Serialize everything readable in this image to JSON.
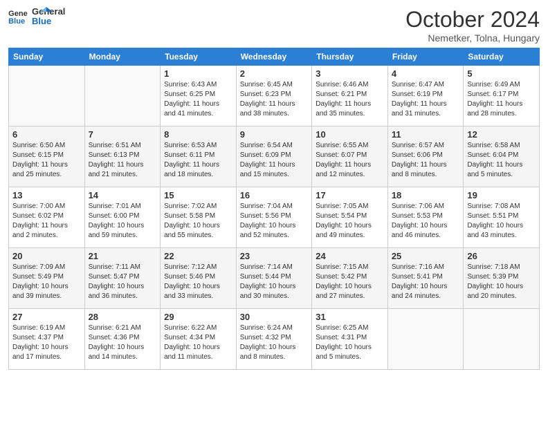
{
  "header": {
    "logo_general": "General",
    "logo_blue": "Blue",
    "month_title": "October 2024",
    "subtitle": "Nemetker, Tolna, Hungary"
  },
  "days_of_week": [
    "Sunday",
    "Monday",
    "Tuesday",
    "Wednesday",
    "Thursday",
    "Friday",
    "Saturday"
  ],
  "weeks": [
    [
      {
        "day": "",
        "info": ""
      },
      {
        "day": "",
        "info": ""
      },
      {
        "day": "1",
        "info": "Sunrise: 6:43 AM\nSunset: 6:25 PM\nDaylight: 11 hours and 41 minutes."
      },
      {
        "day": "2",
        "info": "Sunrise: 6:45 AM\nSunset: 6:23 PM\nDaylight: 11 hours and 38 minutes."
      },
      {
        "day": "3",
        "info": "Sunrise: 6:46 AM\nSunset: 6:21 PM\nDaylight: 11 hours and 35 minutes."
      },
      {
        "day": "4",
        "info": "Sunrise: 6:47 AM\nSunset: 6:19 PM\nDaylight: 11 hours and 31 minutes."
      },
      {
        "day": "5",
        "info": "Sunrise: 6:49 AM\nSunset: 6:17 PM\nDaylight: 11 hours and 28 minutes."
      }
    ],
    [
      {
        "day": "6",
        "info": "Sunrise: 6:50 AM\nSunset: 6:15 PM\nDaylight: 11 hours and 25 minutes."
      },
      {
        "day": "7",
        "info": "Sunrise: 6:51 AM\nSunset: 6:13 PM\nDaylight: 11 hours and 21 minutes."
      },
      {
        "day": "8",
        "info": "Sunrise: 6:53 AM\nSunset: 6:11 PM\nDaylight: 11 hours and 18 minutes."
      },
      {
        "day": "9",
        "info": "Sunrise: 6:54 AM\nSunset: 6:09 PM\nDaylight: 11 hours and 15 minutes."
      },
      {
        "day": "10",
        "info": "Sunrise: 6:55 AM\nSunset: 6:07 PM\nDaylight: 11 hours and 12 minutes."
      },
      {
        "day": "11",
        "info": "Sunrise: 6:57 AM\nSunset: 6:06 PM\nDaylight: 11 hours and 8 minutes."
      },
      {
        "day": "12",
        "info": "Sunrise: 6:58 AM\nSunset: 6:04 PM\nDaylight: 11 hours and 5 minutes."
      }
    ],
    [
      {
        "day": "13",
        "info": "Sunrise: 7:00 AM\nSunset: 6:02 PM\nDaylight: 11 hours and 2 minutes."
      },
      {
        "day": "14",
        "info": "Sunrise: 7:01 AM\nSunset: 6:00 PM\nDaylight: 10 hours and 59 minutes."
      },
      {
        "day": "15",
        "info": "Sunrise: 7:02 AM\nSunset: 5:58 PM\nDaylight: 10 hours and 55 minutes."
      },
      {
        "day": "16",
        "info": "Sunrise: 7:04 AM\nSunset: 5:56 PM\nDaylight: 10 hours and 52 minutes."
      },
      {
        "day": "17",
        "info": "Sunrise: 7:05 AM\nSunset: 5:54 PM\nDaylight: 10 hours and 49 minutes."
      },
      {
        "day": "18",
        "info": "Sunrise: 7:06 AM\nSunset: 5:53 PM\nDaylight: 10 hours and 46 minutes."
      },
      {
        "day": "19",
        "info": "Sunrise: 7:08 AM\nSunset: 5:51 PM\nDaylight: 10 hours and 43 minutes."
      }
    ],
    [
      {
        "day": "20",
        "info": "Sunrise: 7:09 AM\nSunset: 5:49 PM\nDaylight: 10 hours and 39 minutes."
      },
      {
        "day": "21",
        "info": "Sunrise: 7:11 AM\nSunset: 5:47 PM\nDaylight: 10 hours and 36 minutes."
      },
      {
        "day": "22",
        "info": "Sunrise: 7:12 AM\nSunset: 5:46 PM\nDaylight: 10 hours and 33 minutes."
      },
      {
        "day": "23",
        "info": "Sunrise: 7:14 AM\nSunset: 5:44 PM\nDaylight: 10 hours and 30 minutes."
      },
      {
        "day": "24",
        "info": "Sunrise: 7:15 AM\nSunset: 5:42 PM\nDaylight: 10 hours and 27 minutes."
      },
      {
        "day": "25",
        "info": "Sunrise: 7:16 AM\nSunset: 5:41 PM\nDaylight: 10 hours and 24 minutes."
      },
      {
        "day": "26",
        "info": "Sunrise: 7:18 AM\nSunset: 5:39 PM\nDaylight: 10 hours and 20 minutes."
      }
    ],
    [
      {
        "day": "27",
        "info": "Sunrise: 6:19 AM\nSunset: 4:37 PM\nDaylight: 10 hours and 17 minutes."
      },
      {
        "day": "28",
        "info": "Sunrise: 6:21 AM\nSunset: 4:36 PM\nDaylight: 10 hours and 14 minutes."
      },
      {
        "day": "29",
        "info": "Sunrise: 6:22 AM\nSunset: 4:34 PM\nDaylight: 10 hours and 11 minutes."
      },
      {
        "day": "30",
        "info": "Sunrise: 6:24 AM\nSunset: 4:32 PM\nDaylight: 10 hours and 8 minutes."
      },
      {
        "day": "31",
        "info": "Sunrise: 6:25 AM\nSunset: 4:31 PM\nDaylight: 10 hours and 5 minutes."
      },
      {
        "day": "",
        "info": ""
      },
      {
        "day": "",
        "info": ""
      }
    ]
  ]
}
